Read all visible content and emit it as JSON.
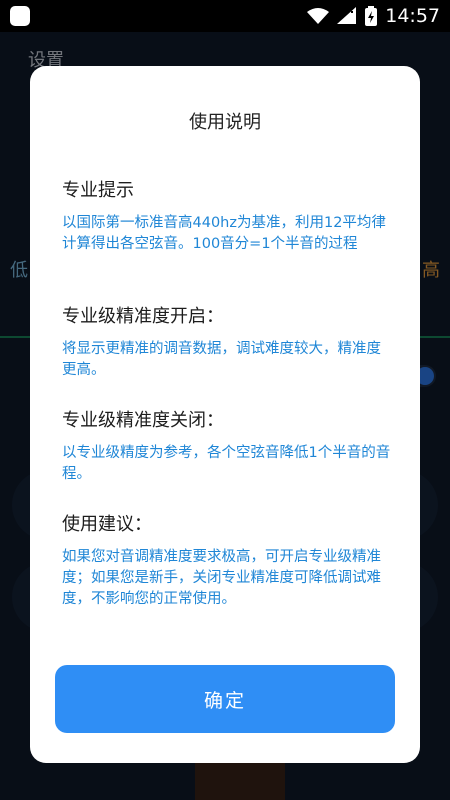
{
  "status_bar": {
    "time": "14:57"
  },
  "background": {
    "title": "设置",
    "low_label": "低",
    "high_label": "高"
  },
  "dialog": {
    "title": "使用说明",
    "sections": [
      {
        "heading": "专业提示",
        "body": "以国际第一标准音高440hz为基准，利用12平均律计算得出各空弦音。100音分=1个半音的过程"
      },
      {
        "heading": "专业级精准度开启：",
        "body": "将显示更精准的调音数据，调试难度较大，精准度更高。"
      },
      {
        "heading": "专业级精准度关闭：",
        "body": "以专业级精度为参考，各个空弦音降低1个半音的音程。"
      },
      {
        "heading": "使用建议：",
        "body": "如果您对音调精准度要求极高，可开启专业级精准度；如果您是新手，关闭专业精准度可降低调试难度，不影响您的正常使用。"
      }
    ],
    "confirm_label": "确定"
  },
  "colors": {
    "accent": "#2f8ef5",
    "body_text": "#1f86d6"
  }
}
